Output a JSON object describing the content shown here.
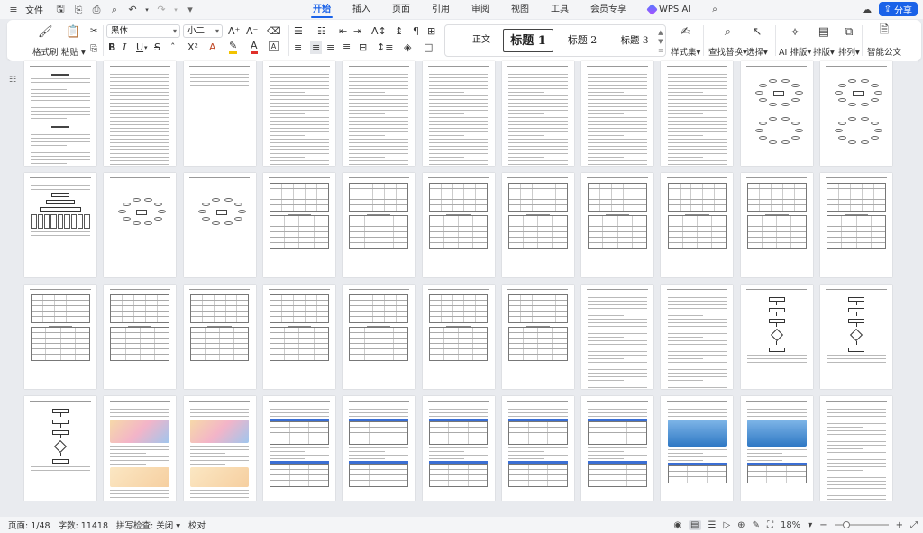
{
  "menu": {
    "file_label": "文件",
    "tabs": [
      {
        "label": "开始",
        "active": true
      },
      {
        "label": "插入"
      },
      {
        "label": "页面"
      },
      {
        "label": "引用"
      },
      {
        "label": "审阅"
      },
      {
        "label": "视图"
      },
      {
        "label": "工具"
      },
      {
        "label": "会员专享"
      }
    ],
    "wps_ai_label": "WPS AI",
    "share_label": "分享"
  },
  "ribbon": {
    "format_painter_label": "格式刷",
    "paste_label": "粘贴",
    "font_name": "黑体",
    "font_size": "小二",
    "styles": [
      "正文",
      "标题 1",
      "标题 2",
      "标题 3"
    ],
    "style_set_label": "样式集",
    "find_replace_label": "查找替换",
    "select_label": "选择",
    "ai_layout_label": "AI 排版",
    "layout_label": "排版",
    "arrange_label": "排列",
    "smart_doc_label": "智能公文"
  },
  "status": {
    "page": "页面: 1/48",
    "words": "字数: 11418",
    "spell": "拼写检查: 关闭",
    "proof": "校对",
    "zoom": "18%",
    "zoom_level": 0.18
  },
  "colors": {
    "accent": "#1a62e8",
    "highlight": "#f2c300",
    "font_color": "#e0302a"
  }
}
